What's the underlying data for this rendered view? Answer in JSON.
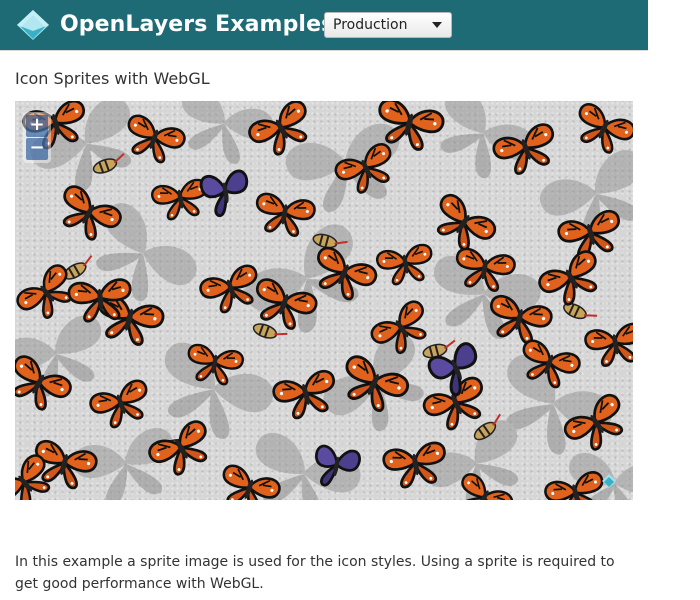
{
  "header": {
    "brand_title": "OpenLayers Examples",
    "logo_icon": "openlayers-logo-icon",
    "version_selected": "Production",
    "background_color": "#1f6b75"
  },
  "page": {
    "title": "Icon Sprites with WebGL",
    "description": "In this example a sprite image is used for the icon styles. Using a sprite is required to get good performance with WebGL."
  },
  "map": {
    "zoom_in_label": "+",
    "zoom_out_label": "−",
    "attribution_icon": "openlayers-attribution-icon"
  }
}
